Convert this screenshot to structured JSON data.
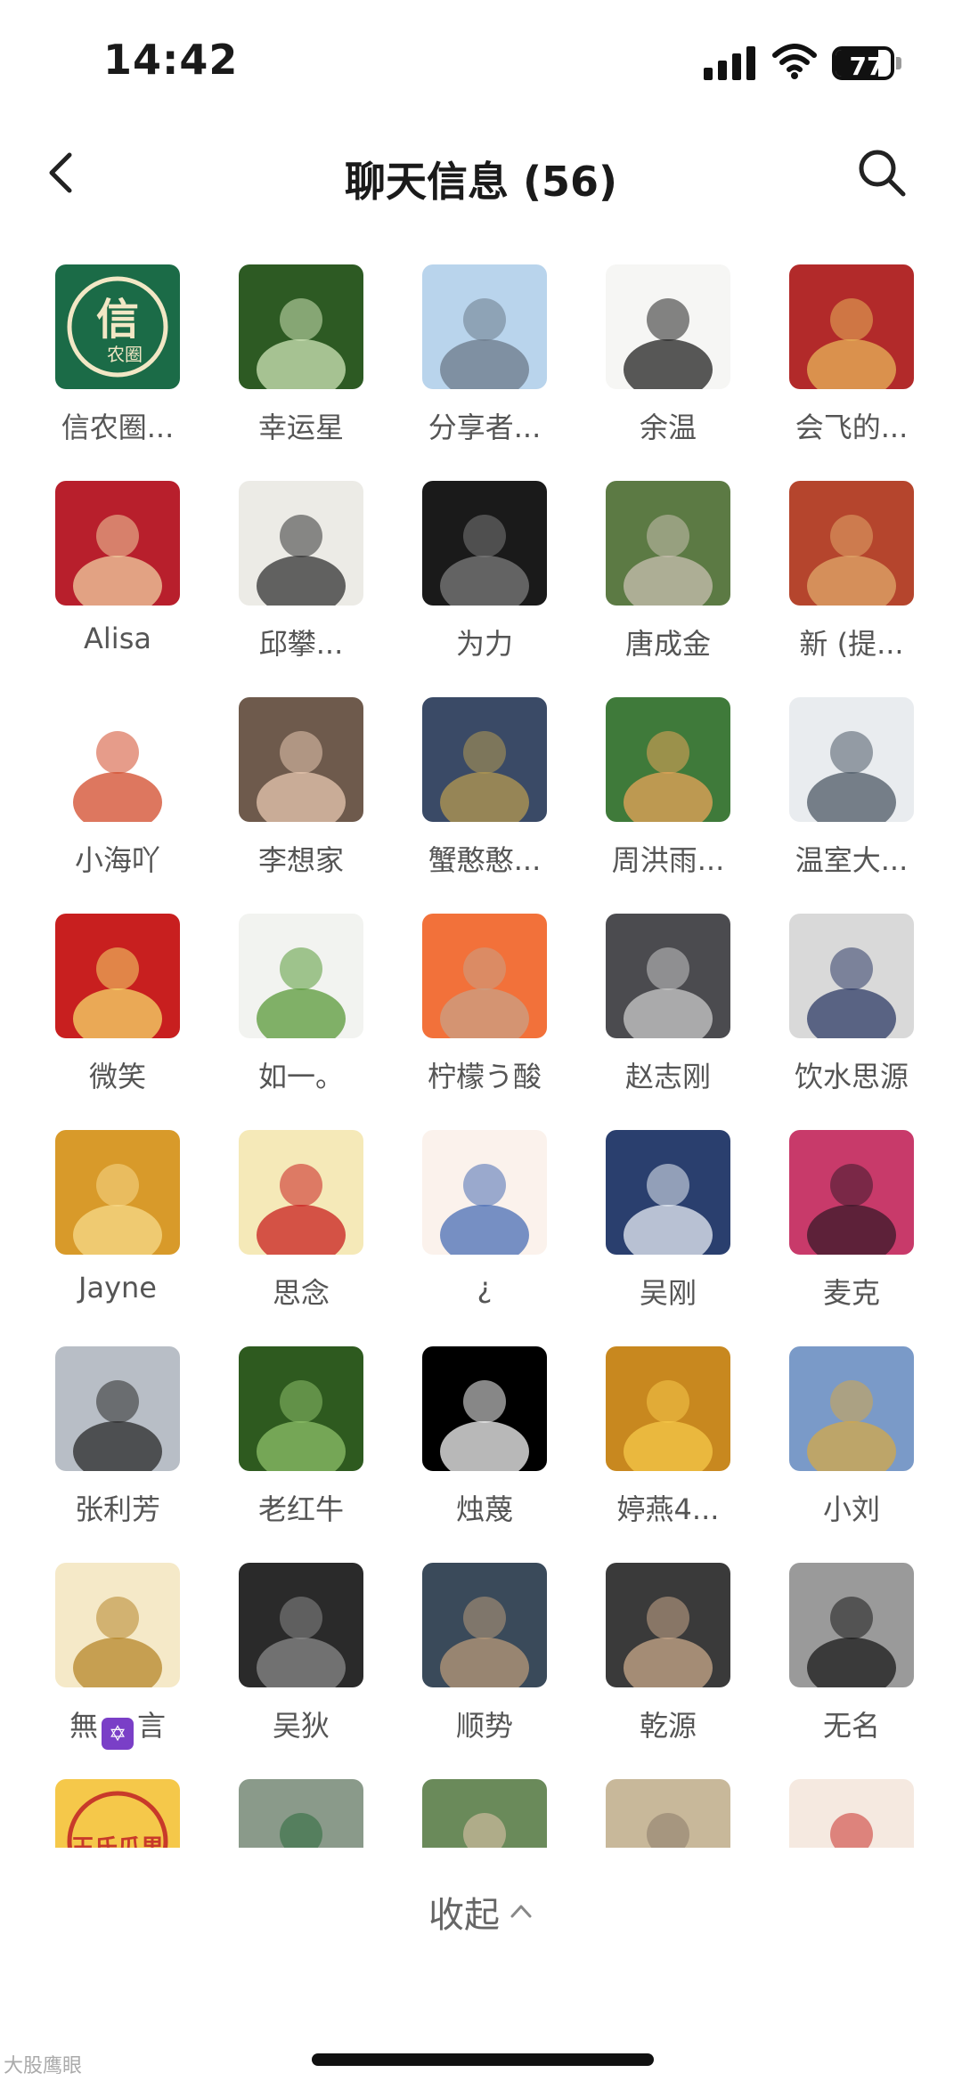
{
  "status_bar": {
    "time": "14:42",
    "battery": "77",
    "battery_level": 0.77
  },
  "nav": {
    "title": "聊天信息 (56)",
    "back_icon": "chevron-left-icon",
    "search_icon": "search-icon"
  },
  "members": [
    {
      "name": "信农圈...",
      "avatar_text": "信",
      "avatar_sub": "农圈",
      "colors": [
        "#1b6b47",
        "#f2e7c5"
      ]
    },
    {
      "name": "幸运星",
      "colors": [
        "#2d5a23",
        "#cfe6b8"
      ]
    },
    {
      "name": "分享者...",
      "colors": [
        "#b9d4ec",
        "#6c7a8a"
      ]
    },
    {
      "name": "余温",
      "colors": [
        "#f6f6f4",
        "#222222"
      ]
    },
    {
      "name": "会飞的...",
      "colors": [
        "#b22a2a",
        "#e7b45a"
      ]
    },
    {
      "name": "Alisa",
      "colors": [
        "#b81f2c",
        "#f0cfa0"
      ]
    },
    {
      "name": "邱攀...",
      "colors": [
        "#ecebe6",
        "#333333"
      ]
    },
    {
      "name": "为力",
      "colors": [
        "#1a1a1a",
        "#7c7c7c"
      ]
    },
    {
      "name": "唐成金",
      "colors": [
        "#5c7a44",
        "#c8c0b0"
      ]
    },
    {
      "name": "新 (提...",
      "colors": [
        "#b5452d",
        "#e0a86a"
      ]
    },
    {
      "name": "小海吖",
      "colors": [
        "#ffffff",
        "#d14a2a"
      ]
    },
    {
      "name": "李想家",
      "colors": [
        "#6e5a4c",
        "#e8c8b0"
      ]
    },
    {
      "name": "蟹憨憨...",
      "colors": [
        "#3a4a66",
        "#b59a52"
      ]
    },
    {
      "name": "周洪雨...",
      "colors": [
        "#3f7a3a",
        "#e8a45a"
      ]
    },
    {
      "name": "温室大...",
      "colors": [
        "#e9ecef",
        "#4d5a66"
      ]
    },
    {
      "name": "微笑",
      "colors": [
        "#c81f1f",
        "#f5d86a"
      ]
    },
    {
      "name": "如一。",
      "colors": [
        "#f2f3f0",
        "#5a9a3a"
      ]
    },
    {
      "name": "柠檬う酸",
      "colors": [
        "#f2713a",
        "#c9a086"
      ]
    },
    {
      "name": "赵志刚",
      "colors": [
        "#4b4b4f",
        "#c9c9c9"
      ]
    },
    {
      "name": "饮水思源",
      "colors": [
        "#d9d9d9",
        "#2d3b66"
      ]
    },
    {
      "name": "Jayne",
      "colors": [
        "#d89a2a",
        "#f7d98a"
      ]
    },
    {
      "name": "思念",
      "colors": [
        "#f5e9b8",
        "#c81f1f"
      ]
    },
    {
      "name": "¿",
      "colors": [
        "#fbf2ec",
        "#4a6eb5"
      ]
    },
    {
      "name": "吴刚",
      "colors": [
        "#2a3f6e",
        "#e8eef5"
      ]
    },
    {
      "name": "麦克",
      "colors": [
        "#c83a6a",
        "#3a1a2a"
      ]
    },
    {
      "name": "张利芳",
      "colors": [
        "#b8bec6",
        "#2a2a2a"
      ]
    },
    {
      "name": "老红牛",
      "colors": [
        "#2e5a1f",
        "#8ec06a"
      ]
    },
    {
      "name": "烛蔑",
      "colors": [
        "#000000",
        "#f5f5f5"
      ]
    },
    {
      "name": "婷燕4...",
      "colors": [
        "#c8881f",
        "#f5c84a"
      ]
    },
    {
      "name": "小刘",
      "colors": [
        "#7a9ac8",
        "#d4a84a"
      ]
    },
    {
      "name": "無",
      "name_suffix": "言",
      "badge": "✡",
      "colors": [
        "#f5e9c8",
        "#b5852a"
      ]
    },
    {
      "name": "吴狄",
      "colors": [
        "#2a2a2a",
        "#8a8a8a"
      ]
    },
    {
      "name": "顺势",
      "colors": [
        "#3a4a5a",
        "#b89a7a"
      ]
    },
    {
      "name": "乾源",
      "colors": [
        "#3a3a3a",
        "#c8a88a"
      ]
    },
    {
      "name": "无名",
      "colors": [
        "#9a9a9a",
        "#1a1a1a"
      ]
    },
    {
      "name": "",
      "avatar_text": "王氏瓜果",
      "colors": [
        "#f5c84a",
        "#c83a2a"
      ]
    },
    {
      "name": "",
      "colors": [
        "#8a9a8a",
        "#2a6a3a"
      ]
    },
    {
      "name": "",
      "colors": [
        "#6a8a5a",
        "#e8c8b0"
      ]
    },
    {
      "name": "",
      "colors": [
        "#c8b89a",
        "#8a7a6a"
      ]
    },
    {
      "name": "",
      "colors": [
        "#f5e9e0",
        "#c8302a"
      ]
    }
  ],
  "collapse": {
    "label": "收起",
    "icon": "chevron-up-icon"
  },
  "watermark": "大股鹰眼"
}
